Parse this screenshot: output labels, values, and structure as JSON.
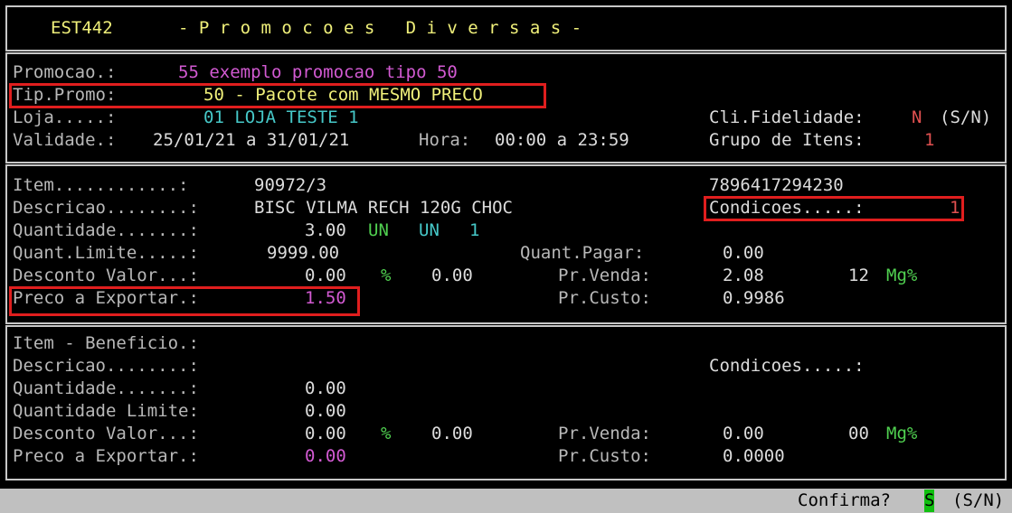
{
  "header": {
    "code": "EST442",
    "title": "- P r o m o c o e s   D i v e r s a s -"
  },
  "promo": {
    "promocao_label": "Promocao.:",
    "promocao_value": "55 exemplo promocao tipo 50",
    "tip_label": "Tip.Promo:",
    "tip_value": "50 - Pacote com MESMO PRECO",
    "loja_label": "Loja.....:",
    "loja_value": "01 LOJA TESTE 1",
    "fidel_label": "Cli.Fidelidade:",
    "fidel_value": "N",
    "fidel_opts": "(S/N)",
    "validade_label": "Validade.:",
    "validade_value": "25/01/21 a 31/01/21",
    "hora_label": "Hora:",
    "hora_value": "00:00 a 23:59",
    "grupo_label": "Grupo de Itens:",
    "grupo_value": "1"
  },
  "item": {
    "item_label": "Item............:",
    "item_value": "90972/3",
    "ean": "7896417294230",
    "desc_label": "Descricao........:",
    "desc_value": "BISC VILMA RECH 120G CHOC",
    "cond_label": "Condicoes.....:",
    "cond_value": "1",
    "qtd_label": "Quantidade.......:",
    "qtd_value": "3.00",
    "qtd_un1": "UN",
    "qtd_un2": "UN",
    "qtd_un3": "1",
    "qlim_label": "Quant.Limite.....:",
    "qlim_value": "9999.00",
    "qpag_label": "Quant.Pagar:",
    "qpag_value": "0.00",
    "dval_label": "Desconto Valor...:",
    "dval_value": "0.00",
    "pct": "%",
    "dpct_value": "0.00",
    "prvenda_label": "Pr.Venda:",
    "prvenda_value": "2.08",
    "mg_value": "12",
    "mg_label": "Mg%",
    "preco_label": "Preco a Exportar.:",
    "preco_value": "1.50",
    "prcusto_label": "Pr.Custo:",
    "prcusto_value": "0.9986"
  },
  "benef": {
    "item_label": "Item - Beneficio.:",
    "desc_label": "Descricao........:",
    "cond_label": "Condicoes.....:",
    "qtd_label": "Quantidade.......:",
    "qtd_value": "0.00",
    "qlim_label": "Quantidade Limite:",
    "qlim_value": "0.00",
    "dval_label": "Desconto Valor...:",
    "dval_value": "0.00",
    "pct": "%",
    "dpct_value": "0.00",
    "prvenda_label": "Pr.Venda:",
    "prvenda_value": "0.00",
    "mg_value": "00",
    "mg_label": "Mg%",
    "preco_label": "Preco a Exportar.:",
    "preco_value": "0.00",
    "prcusto_label": "Pr.Custo:",
    "prcusto_value": "0.0000"
  },
  "status": {
    "confirm_label": "Confirma?",
    "confirm_value": "S",
    "confirm_opts": "(S/N)"
  },
  "colors": {
    "background": "#000000",
    "label": "#dcdcdc",
    "title": "#f0f07a",
    "magenta": "#d25ad2",
    "cyan": "#46c8c8",
    "red": "#e05050",
    "green": "#50d050",
    "highlight": "#e01e1e",
    "statusbar": "#c0c0c0"
  }
}
